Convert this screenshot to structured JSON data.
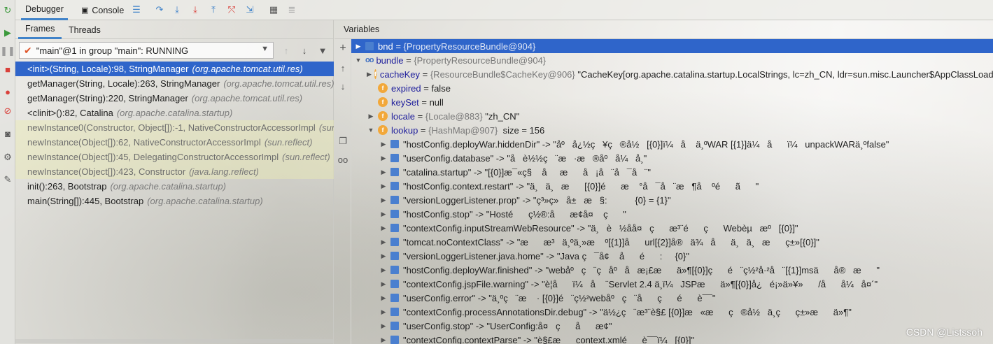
{
  "toolbar": {
    "debugger_tab": "Debugger",
    "console_tab": "Console"
  },
  "frames_panel": {
    "frames_tab": "Frames",
    "threads_tab": "Threads",
    "thread_selector": "\"main\"@1 in group \"main\": RUNNING",
    "frames": [
      {
        "method": "<init>(String, Locale):98, StringManager",
        "pkg": "(org.apache.tomcat.util.res)",
        "selected": true,
        "library": false
      },
      {
        "method": "getManager(String, Locale):263, StringManager",
        "pkg": "(org.apache.tomcat.util.res)",
        "selected": false,
        "library": false
      },
      {
        "method": "getManager(String):220, StringManager",
        "pkg": "(org.apache.tomcat.util.res)",
        "selected": false,
        "library": false
      },
      {
        "method": "<clinit>():82, Catalina",
        "pkg": "(org.apache.catalina.startup)",
        "selected": false,
        "library": false
      },
      {
        "method": "newInstance0(Constructor, Object[]):-1, NativeConstructorAccessorImpl",
        "pkg": "(sun",
        "selected": false,
        "library": true
      },
      {
        "method": "newInstance(Object[]):62, NativeConstructorAccessorImpl",
        "pkg": "(sun.reflect)",
        "selected": false,
        "library": true
      },
      {
        "method": "newInstance(Object[]):45, DelegatingConstructorAccessorImpl",
        "pkg": "(sun.reflect)",
        "selected": false,
        "library": true
      },
      {
        "method": "newInstance(Object[]):423, Constructor",
        "pkg": "(java.lang.reflect)",
        "selected": false,
        "library": true
      },
      {
        "method": "init():263, Bootstrap",
        "pkg": "(org.apache.catalina.startup)",
        "selected": false,
        "library": false
      },
      {
        "method": "main(String[]):445, Bootstrap",
        "pkg": "(org.apache.catalina.startup)",
        "selected": false,
        "library": false
      }
    ]
  },
  "variables_panel": {
    "header": "Variables",
    "rows": [
      {
        "indent": 0,
        "toggle": "▶",
        "badge": "m",
        "name": "bnd",
        "eq": " = ",
        "type": "{PropertyResourceBundle@904}",
        "value": "",
        "selected": true
      },
      {
        "indent": 0,
        "toggle": "▼",
        "badge": "oo",
        "name": "bundle",
        "eq": " = ",
        "type": "{PropertyResourceBundle@904}",
        "value": "",
        "selected": false
      },
      {
        "indent": 1,
        "toggle": "▶",
        "badge": "f",
        "name": "cacheKey",
        "eq": " = ",
        "type": "{ResourceBundle$CacheKey@906}",
        "value": " \"CacheKey[org.apache.catalina.startup.LocalStrings, lc=zh_CN, ldr=sun.misc.Launcher$AppClassLoade",
        "selected": false
      },
      {
        "indent": 1,
        "toggle": "",
        "badge": "f",
        "name": "expired",
        "eq": " = ",
        "type": "",
        "value": "false",
        "selected": false
      },
      {
        "indent": 1,
        "toggle": "",
        "badge": "f",
        "name": "keySet",
        "eq": " = ",
        "type": "",
        "value": "null",
        "selected": false
      },
      {
        "indent": 1,
        "toggle": "▶",
        "badge": "f",
        "name": "locale",
        "eq": " = ",
        "type": "{Locale@883}",
        "value": " \"zh_CN\"",
        "selected": false
      },
      {
        "indent": 1,
        "toggle": "▼",
        "badge": "f",
        "name": "lookup",
        "eq": " = ",
        "type": "{HashMap@907}",
        "value": "  size = 156",
        "selected": false
      },
      {
        "indent": 2,
        "toggle": "▶",
        "badge": "m",
        "name": "",
        "eq": "",
        "type": "",
        "value": "\"hostConfig.deployWar.hiddenDir\" -> \"åº   å¿½ç   ¥ç   ®å½   [{0}]ï¼   å    ä¸ºWAR [{1}]ä¼   å      ï¼   unpackWARä¸ºfalse\"",
        "selected": false
      },
      {
        "indent": 2,
        "toggle": "▶",
        "badge": "m",
        "name": "",
        "eq": "",
        "type": "",
        "value": "\"userConfig.database\" -> \"å   è½½ç   ¨æ   ·æ   ®åº   å¼   å¸\"",
        "selected": false
      },
      {
        "indent": 2,
        "toggle": "▶",
        "badge": "m",
        "name": "",
        "eq": "",
        "type": "",
        "value": "\"catalina.startup\" -> \"[{0}]æ¯«ç§    å     æ      å   ¡å   ¨å   ¯å   ¨\"",
        "selected": false
      },
      {
        "indent": 2,
        "toggle": "▶",
        "badge": "m",
        "name": "",
        "eq": "",
        "type": "",
        "value": "\"hostConfig.context.restart\" -> \"ä¸   ä¸   æ      [{0}]é      æ    °å   ¯å   ¨æ   ¶å    ºé      ã      \"",
        "selected": false
      },
      {
        "indent": 2,
        "toggle": "▶",
        "badge": "m",
        "name": "",
        "eq": "",
        "type": "",
        "value": "\"versionLoggerListener.prop\" -> \"ç³»ç»   å±   æ   §:           {0} = {1}\"",
        "selected": false
      },
      {
        "indent": 2,
        "toggle": "▶",
        "badge": "m",
        "name": "",
        "eq": "",
        "type": "",
        "value": "\"hostConfig.stop\" -> \"Hosté      ç½®:å      æ¢å¤    ç      \"",
        "selected": false
      },
      {
        "indent": 2,
        "toggle": "▶",
        "badge": "m",
        "name": "",
        "eq": "",
        "type": "",
        "value": "\"contextConfig.inputStreamWebResource\" -> \"ä¸   è   ½åå¤   ç      æ³¨é      ç      Webèµ   æº   [{0}]\"",
        "selected": false
      },
      {
        "indent": 2,
        "toggle": "▶",
        "badge": "m",
        "name": "",
        "eq": "",
        "type": "",
        "value": "\"tomcat.noContextClass\" -> \"æ      æ³   ä¸ºä¸»æ    º[{1}]å      url[{2}]å®   ä¾   å      ä¸   ä¸   æ      ç±»[{0}]\"",
        "selected": false
      },
      {
        "indent": 2,
        "toggle": "▶",
        "badge": "m",
        "name": "",
        "eq": "",
        "type": "",
        "value": "\"versionLoggerListener.java.home\" -> \"Java ç   ¯å¢    å      é      :     {0}\"",
        "selected": false
      },
      {
        "indent": 2,
        "toggle": "▶",
        "badge": "m",
        "name": "",
        "eq": "",
        "type": "",
        "value": "\"hostConfig.deployWar.finished\" -> \"webåº   ç   ¨ç   åº   å   æ¡£æ      ä»¶[{0}]ç      é   ¨ç½²å·²å   ¨[{1}]msä      å®   æ      \"",
        "selected": false
      },
      {
        "indent": 2,
        "toggle": "▶",
        "badge": "m",
        "name": "",
        "eq": "",
        "type": "",
        "value": "\"contextConfig.jspFile.warning\" -> \"è¦å      ï¼   å    ¨Servlet 2.4 ä¸ï¼   JSPæ      ä»¶[{0}]å¿   é¡»ä»¥»      /å      å¼   å¤´\"",
        "selected": false
      },
      {
        "indent": 2,
        "toggle": "▶",
        "badge": "m",
        "name": "",
        "eq": "",
        "type": "",
        "value": "\"userConfig.error\" -> \"ä¸ºç   ¨æ    · [{0}]é   ¨ç½²webåº   ç   ¨å      ç      é      è¯¯\"",
        "selected": false
      },
      {
        "indent": 2,
        "toggle": "▶",
        "badge": "m",
        "name": "",
        "eq": "",
        "type": "",
        "value": "\"contextConfig.processAnnotationsDir.debug\" -> \"ä½¿ç   ¨æ³¨è§£ [{0}]æ   «æ      ç   ®å½   ä¸ç      ç±»æ      ä»¶\"",
        "selected": false
      },
      {
        "indent": 2,
        "toggle": "▶",
        "badge": "m",
        "name": "",
        "eq": "",
        "type": "",
        "value": "\"userConfig.stop\" -> \"UserConfig:å¤   ç      å      æ¢\"",
        "selected": false
      },
      {
        "indent": 2,
        "toggle": "▶",
        "badge": "m",
        "name": "",
        "eq": "",
        "type": "",
        "value": "\"contextConfig.contextParse\" -> \"è§£æ      context.xmlé      è¯¯ï¼   [{0}]\"",
        "selected": false
      }
    ]
  },
  "watermark": "CSDN @Listssoh"
}
